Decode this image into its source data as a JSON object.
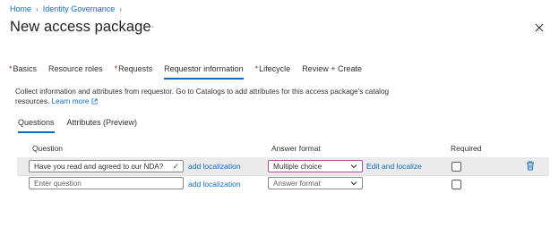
{
  "breadcrumb": {
    "home": "Home",
    "identity_governance": "Identity Governance"
  },
  "page": {
    "title": "New access package",
    "more": "···"
  },
  "tabs": [
    {
      "label": "Basics",
      "required": true
    },
    {
      "label": "Resource roles",
      "required": false
    },
    {
      "label": "Requests",
      "required": true
    },
    {
      "label": "Requestor information",
      "required": false,
      "active": true
    },
    {
      "label": "Lifecycle",
      "required": true
    },
    {
      "label": "Review + Create",
      "required": false
    }
  ],
  "required_marker": "*",
  "description": {
    "text": "Collect information and attributes from requestor. Go to Catalogs to add attributes for this access package's catalog resources.",
    "learn_more": "Learn more"
  },
  "subtabs": {
    "questions": "Questions",
    "attributes": "Attributes (Preview)"
  },
  "table": {
    "col_question": "Question",
    "col_answer_format": "Answer format",
    "col_required": "Required"
  },
  "rows": [
    {
      "question_value": "Have you read and agreed to our NDA?",
      "add_localization": "add localization",
      "answer_format": "Multiple choice",
      "edit_localize": "Edit and localize",
      "required": false
    },
    {
      "question_placeholder": "Enter question",
      "add_localization": "add localization",
      "answer_format_placeholder": "Answer format",
      "required": false
    }
  ],
  "colors": {
    "accent": "#0f6cbd",
    "required": "#a4262c",
    "valid": "#107c10",
    "selected_border": "#b24e9c"
  }
}
